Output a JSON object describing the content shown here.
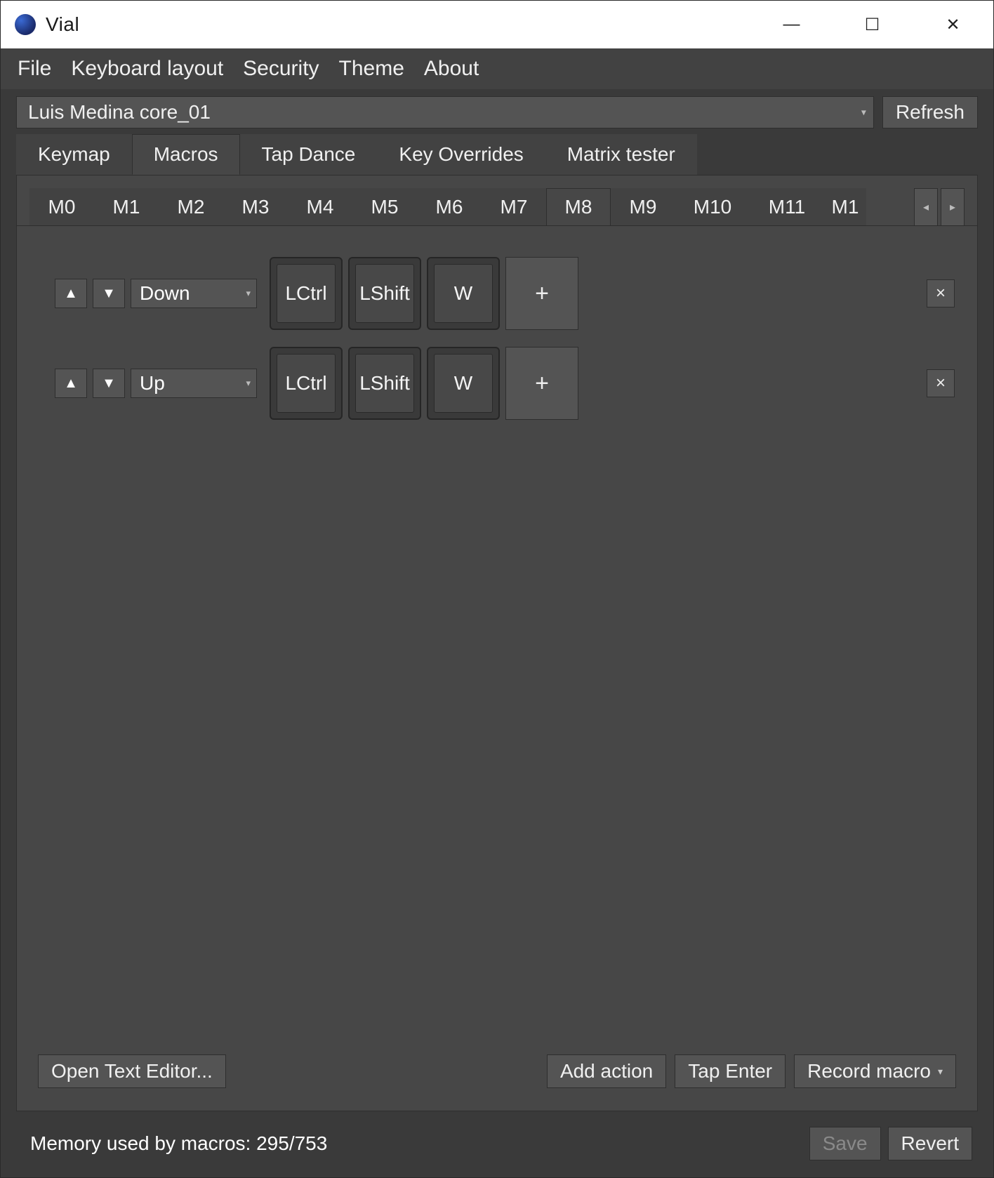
{
  "window": {
    "title": "Vial"
  },
  "menu": {
    "file": "File",
    "keyboard_layout": "Keyboard layout",
    "security": "Security",
    "theme": "Theme",
    "about": "About"
  },
  "device": {
    "selected": "Luis Medina core_01",
    "refresh": "Refresh"
  },
  "tabs": {
    "keymap": "Keymap",
    "macros": "Macros",
    "tap_dance": "Tap Dance",
    "key_overrides": "Key Overrides",
    "matrix_tester": "Matrix tester",
    "active": "macros"
  },
  "macro_tabs": [
    "M0",
    "M1",
    "M2",
    "M3",
    "M4",
    "M5",
    "M6",
    "M7",
    "M8",
    "M9",
    "M10",
    "M11",
    "M1"
  ],
  "macro_active_index": 8,
  "rows": [
    {
      "type": "Down",
      "keys": [
        "LCtrl",
        "LShift",
        "W"
      ]
    },
    {
      "type": "Up",
      "keys": [
        "LCtrl",
        "LShift",
        "W"
      ]
    }
  ],
  "actions": {
    "open_editor": "Open Text Editor...",
    "add_action": "Add action",
    "tap_enter": "Tap Enter",
    "record_macro": "Record macro"
  },
  "status": {
    "memory": "Memory used by macros: 295/753",
    "save": "Save",
    "revert": "Revert"
  },
  "glyphs": {
    "up": "▲",
    "down": "▼",
    "plus": "+",
    "close": "×",
    "left": "◂",
    "right": "▸",
    "dd": "▾",
    "min": "—",
    "max": "☐",
    "winclose": "✕"
  }
}
